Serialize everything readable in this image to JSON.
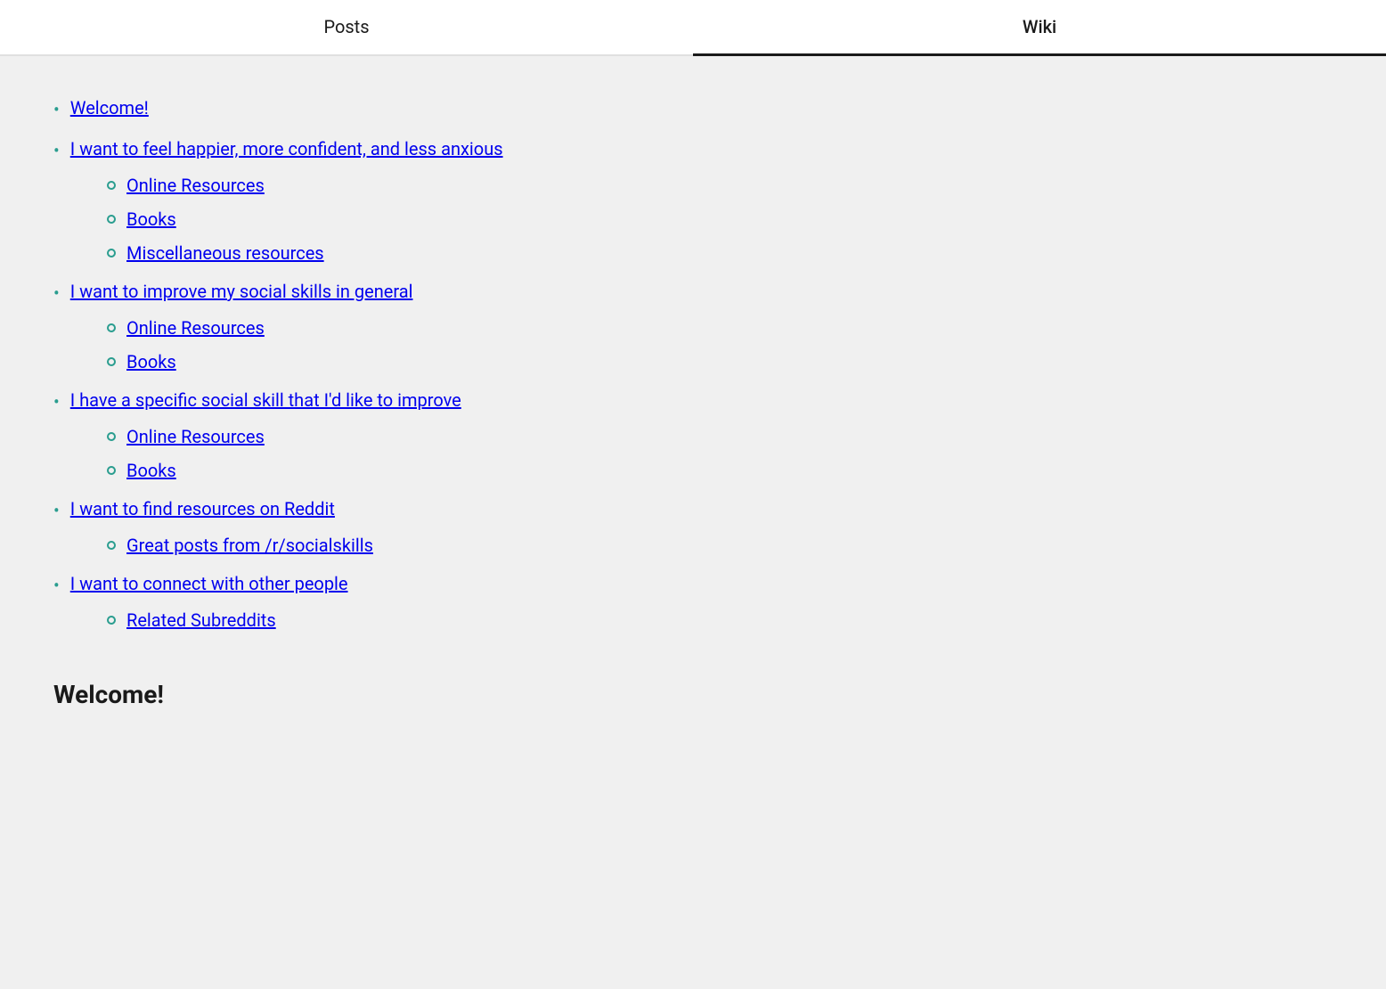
{
  "tabs": [
    {
      "id": "posts",
      "label": "Posts",
      "active": false
    },
    {
      "id": "wiki",
      "label": "Wiki",
      "active": true
    }
  ],
  "nav": {
    "items": [
      {
        "id": "welcome",
        "label": "Welcome!",
        "link": true,
        "children": []
      },
      {
        "id": "happier",
        "label": "I want to feel happier, more confident, and less anxious",
        "link": true,
        "children": [
          {
            "id": "happier-online",
            "label": "Online Resources",
            "link": true
          },
          {
            "id": "happier-books",
            "label": "Books",
            "link": true
          },
          {
            "id": "happier-misc",
            "label": "Miscellaneous resources",
            "link": true
          }
        ]
      },
      {
        "id": "social-skills",
        "label": "I want to improve my social skills in general",
        "link": true,
        "children": [
          {
            "id": "social-online",
            "label": "Online Resources",
            "link": true
          },
          {
            "id": "social-books",
            "label": "Books",
            "link": true
          }
        ]
      },
      {
        "id": "specific-skill",
        "label": "I have a specific social skill that I'd like to improve",
        "link": true,
        "children": [
          {
            "id": "specific-online",
            "label": "Online Resources",
            "link": true
          },
          {
            "id": "specific-books",
            "label": "Books",
            "link": true
          }
        ]
      },
      {
        "id": "reddit-resources",
        "label": "I want to find resources on Reddit",
        "link": true,
        "children": [
          {
            "id": "reddit-posts",
            "label": "Great posts from /r/socialskills",
            "link": true
          }
        ]
      },
      {
        "id": "connect",
        "label": "I want to connect with other people",
        "link": true,
        "children": [
          {
            "id": "connect-subreddits",
            "label": "Related Subreddits",
            "link": true
          }
        ]
      }
    ],
    "section_heading": "Welcome!"
  },
  "colors": {
    "link": "#2a9d8f",
    "heading": "#1a1a1a",
    "tab_active_border": "#1a1a1a"
  }
}
